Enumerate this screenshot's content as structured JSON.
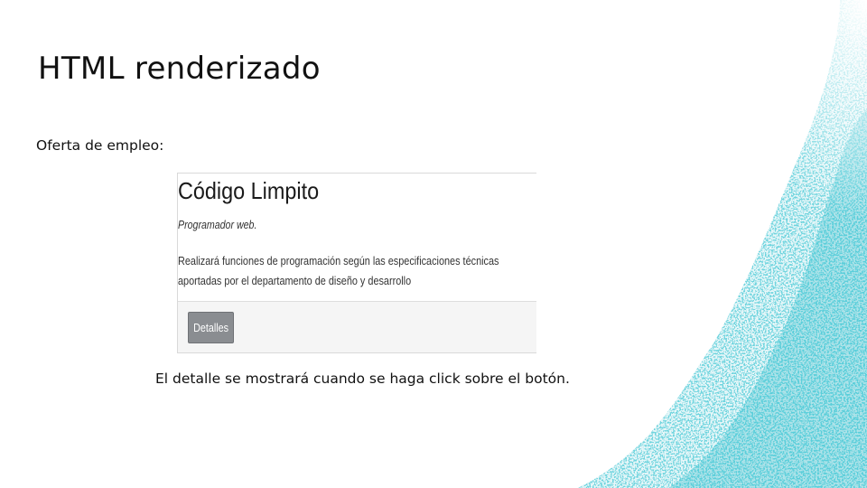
{
  "slide": {
    "title": "HTML renderizado",
    "intro": "Oferta de empleo:",
    "caption": "El detalle se mostrará cuando se haga click sobre el botón."
  },
  "card": {
    "title": "Código Limpito",
    "subtitle": "Programador web.",
    "description": "Realizará funciones de programación según las especificaciones técnicas aportadas por el departamento de diseño y desarrollo",
    "button_label": "Detalles"
  },
  "decoration": {
    "icon": "teal-speckle-texture",
    "colors": [
      "#1aa6b7",
      "#2bc3cf",
      "#0e6f7c",
      "#9fdde4",
      "#d8f1f4"
    ]
  }
}
